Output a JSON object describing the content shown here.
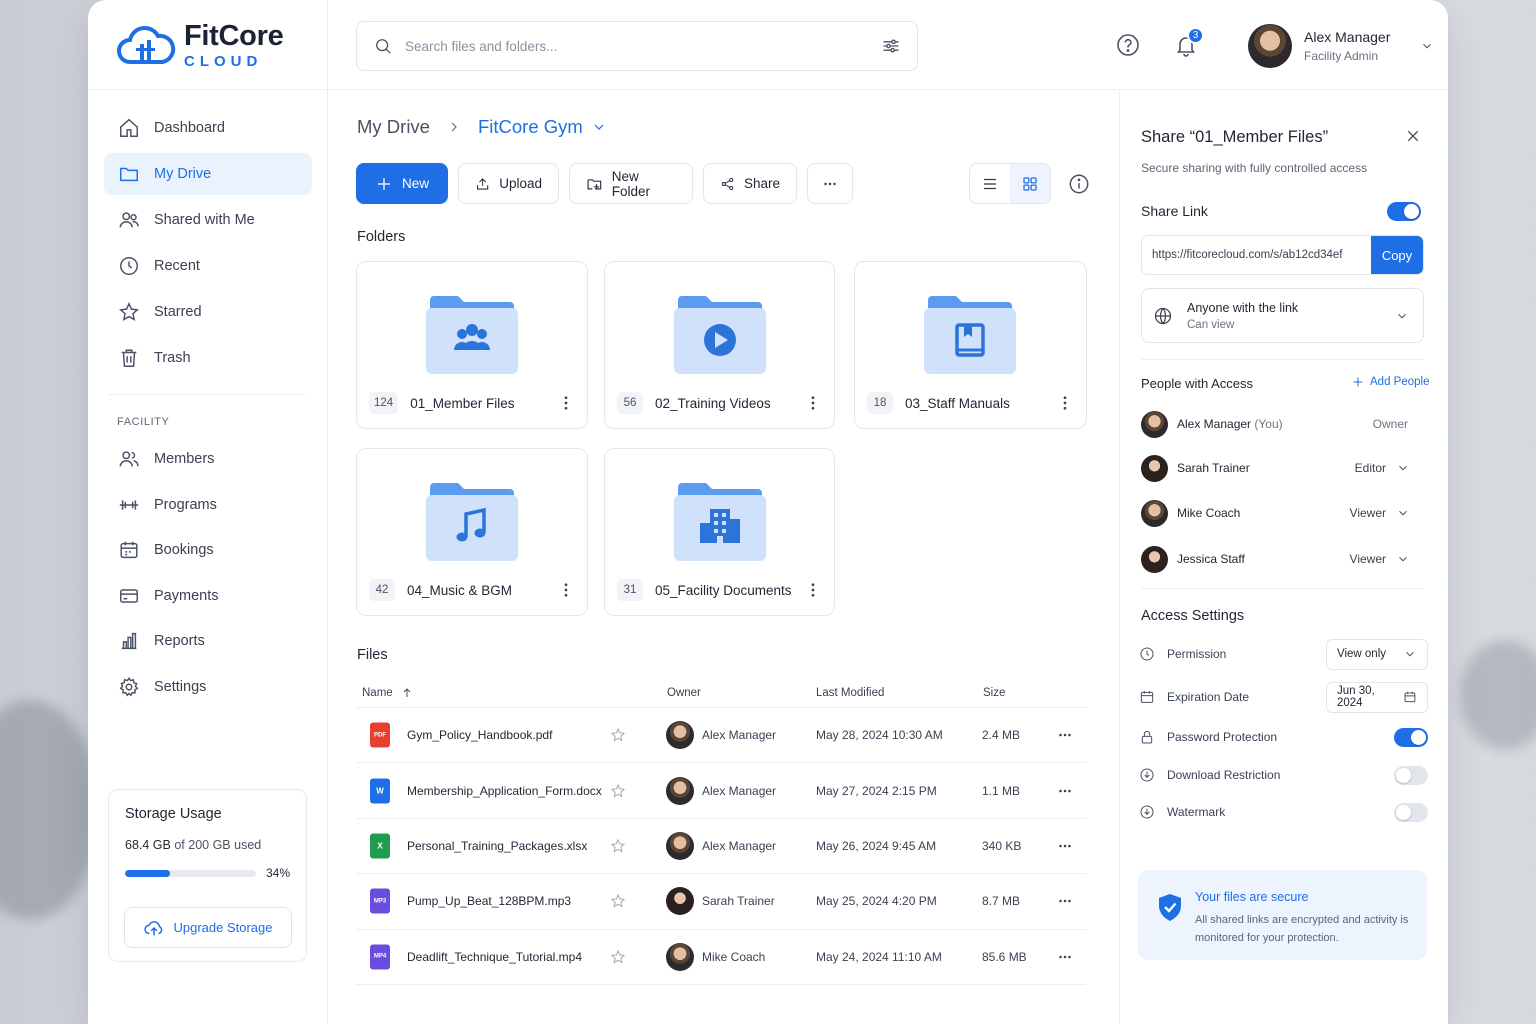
{
  "brand": {
    "name": "FitCore",
    "tagline": "CLOUD",
    "accent": "#1e6fe6"
  },
  "sidebar": {
    "items": [
      {
        "label": "Dashboard",
        "icon": "home-icon"
      },
      {
        "label": "My Drive",
        "icon": "folder-icon",
        "active": true
      },
      {
        "label": "Shared with Me",
        "icon": "users-icon"
      },
      {
        "label": "Recent",
        "icon": "clock-icon"
      },
      {
        "label": "Starred",
        "icon": "star-icon"
      },
      {
        "label": "Trash",
        "icon": "trash-icon"
      }
    ],
    "section_label": "FACILITY",
    "facility_items": [
      {
        "label": "Members",
        "icon": "members-icon"
      },
      {
        "label": "Programs",
        "icon": "dumbbell-icon"
      },
      {
        "label": "Bookings",
        "icon": "calendar-icon"
      },
      {
        "label": "Payments",
        "icon": "credit-card-icon"
      },
      {
        "label": "Reports",
        "icon": "bar-chart-icon"
      },
      {
        "label": "Settings",
        "icon": "gear-icon"
      }
    ],
    "storage": {
      "title": "Storage Usage",
      "used": "68.4 GB",
      "total_text": "of 200 GB used",
      "percent_label": "34%",
      "percent": 34,
      "upgrade_label": "Upgrade Storage"
    }
  },
  "header": {
    "search_placeholder": "Search files and folders...",
    "notification_count": "3",
    "user": {
      "name": "Alex Manager",
      "role": "Facility Admin"
    }
  },
  "main": {
    "breadcrumb": {
      "root": "My Drive",
      "current": "FitCore Gym"
    },
    "toolbar": {
      "new_label": "New",
      "upload_label": "Upload",
      "new_folder_label": "New Folder",
      "share_label": "Share"
    },
    "folders_title": "Folders",
    "folders": [
      {
        "count": "124",
        "name": "01_Member Files",
        "glyph": "users-glyph"
      },
      {
        "count": "56",
        "name": "02_Training Videos",
        "glyph": "play-glyph"
      },
      {
        "count": "18",
        "name": "03_Staff Manuals",
        "glyph": "book-glyph"
      },
      {
        "count": "42",
        "name": "04_Music & BGM",
        "glyph": "music-glyph"
      },
      {
        "count": "31",
        "name": "05_Facility Documents",
        "glyph": "building-glyph"
      }
    ],
    "files_title": "Files",
    "columns": {
      "name": "Name",
      "owner": "Owner",
      "modified": "Last Modified",
      "size": "Size"
    },
    "files": [
      {
        "name": "Gym_Policy_Handbook.pdf",
        "type": "PDF",
        "color": "#e8402f",
        "owner": "Alex Manager",
        "owner_gender": "m",
        "modified": "May 28, 2024 10:30 AM",
        "size": "2.4 MB"
      },
      {
        "name": "Membership_Application_Form.docx",
        "type": "W",
        "color": "#1e6fe6",
        "owner": "Alex Manager",
        "owner_gender": "m",
        "modified": "May 27, 2024 2:15 PM",
        "size": "1.1 MB"
      },
      {
        "name": "Personal_Training_Packages.xlsx",
        "type": "X",
        "color": "#1f9d4c",
        "owner": "Alex Manager",
        "owner_gender": "m",
        "modified": "May 26, 2024 9:45 AM",
        "size": "340 KB"
      },
      {
        "name": "Pump_Up_Beat_128BPM.mp3",
        "type": "MP3",
        "color": "#6a4de0",
        "owner": "Sarah Trainer",
        "owner_gender": "f",
        "modified": "May 25, 2024 4:20 PM",
        "size": "8.7 MB"
      },
      {
        "name": "Deadlift_Technique_Tutorial.mp4",
        "type": "MP4",
        "color": "#6a4de0",
        "owner": "Mike Coach",
        "owner_gender": "m",
        "modified": "May 24, 2024 11:10 AM",
        "size": "85.6 MB"
      }
    ]
  },
  "share_panel": {
    "title": "Share “01_Member Files”",
    "subtitle": "Secure sharing with fully controlled access",
    "share_link_label": "Share Link",
    "share_link_enabled": true,
    "link_url": "https://fitcorecloud.com/s/ab12cd34ef",
    "copy_label": "Copy",
    "access": {
      "main": "Anyone with the link",
      "sub": "Can view"
    },
    "people_title": "People with Access",
    "add_people_label": "Add People",
    "people": [
      {
        "name": "Alex Manager",
        "you": "(You)",
        "role": "Owner",
        "gender": "m"
      },
      {
        "name": "Sarah Trainer",
        "you": "",
        "role": "Editor",
        "gender": "f"
      },
      {
        "name": "Mike Coach",
        "you": "",
        "role": "Viewer",
        "gender": "m"
      },
      {
        "name": "Jessica Staff",
        "you": "",
        "role": "Viewer",
        "gender": "f"
      }
    ],
    "settings_title": "Access Settings",
    "settings": {
      "permission_label": "Permission",
      "permission_value": "View only",
      "expiration_label": "Expiration Date",
      "expiration_value": "Jun 30, 2024",
      "password_label": "Password Protection",
      "password_enabled": true,
      "download_label": "Download Restriction",
      "download_enabled": false,
      "watermark_label": "Watermark",
      "watermark_enabled": false
    },
    "secure": {
      "title": "Your files are secure",
      "text": "All shared links are encrypted and activity is monitored for your protection."
    }
  }
}
